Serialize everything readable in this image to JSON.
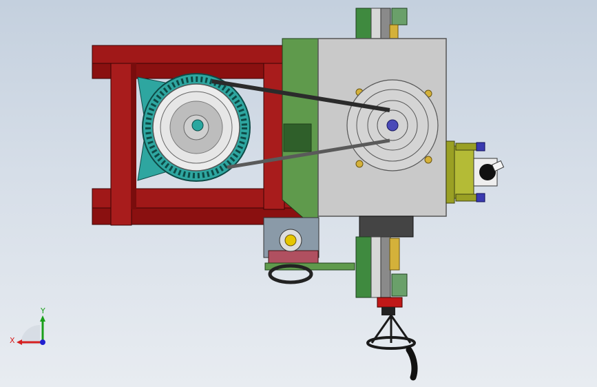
{
  "viewport": {
    "background_top": "#c4d0de",
    "background_bottom": "#e8ecf1"
  },
  "model": {
    "frame_color": "#a01818",
    "motor_color": "#2ea6a0",
    "housing_color": "#c9c9c9",
    "bracket_color": "#5f9a4c",
    "slide_color": "#3f8a3f",
    "clamp_color": "#9aa024",
    "screw_color": "#3a3ab0"
  },
  "triad": {
    "x_label": "X",
    "y_label": "Y",
    "x_color": "#d62020",
    "y_color": "#1aa01a",
    "z_color": "#2020d0"
  }
}
